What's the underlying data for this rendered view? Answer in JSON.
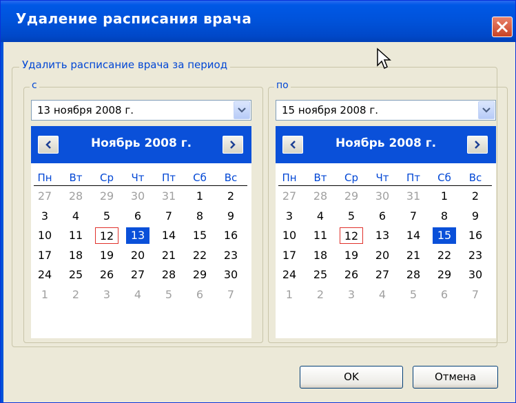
{
  "window": {
    "title": "Удаление расписания врача"
  },
  "group": {
    "legend": "Удалить расписание врача за период"
  },
  "from": {
    "legend": "с",
    "combo_value": "13  ноября   2008 г.",
    "month_label": "Ноябрь 2008 г.",
    "selected": "13",
    "today": "12"
  },
  "to": {
    "legend": "по",
    "combo_value": "15  ноября   2008 г.",
    "month_label": "Ноябрь 2008 г.",
    "selected": "15",
    "today": "12"
  },
  "weekdays": [
    "Пн",
    "Вт",
    "Ср",
    "Чт",
    "Пт",
    "Сб",
    "Вс"
  ],
  "weeks": [
    [
      {
        "d": "27",
        "o": true
      },
      {
        "d": "28",
        "o": true
      },
      {
        "d": "29",
        "o": true
      },
      {
        "d": "30",
        "o": true
      },
      {
        "d": "31",
        "o": true
      },
      {
        "d": "1",
        "o": false
      },
      {
        "d": "2",
        "o": false
      }
    ],
    [
      {
        "d": "3",
        "o": false
      },
      {
        "d": "4",
        "o": false
      },
      {
        "d": "5",
        "o": false
      },
      {
        "d": "6",
        "o": false
      },
      {
        "d": "7",
        "o": false
      },
      {
        "d": "8",
        "o": false
      },
      {
        "d": "9",
        "o": false
      }
    ],
    [
      {
        "d": "10",
        "o": false
      },
      {
        "d": "11",
        "o": false
      },
      {
        "d": "12",
        "o": false
      },
      {
        "d": "13",
        "o": false
      },
      {
        "d": "14",
        "o": false
      },
      {
        "d": "15",
        "o": false
      },
      {
        "d": "16",
        "o": false
      }
    ],
    [
      {
        "d": "17",
        "o": false
      },
      {
        "d": "18",
        "o": false
      },
      {
        "d": "19",
        "o": false
      },
      {
        "d": "20",
        "o": false
      },
      {
        "d": "21",
        "o": false
      },
      {
        "d": "22",
        "o": false
      },
      {
        "d": "23",
        "o": false
      }
    ],
    [
      {
        "d": "24",
        "o": false
      },
      {
        "d": "25",
        "o": false
      },
      {
        "d": "26",
        "o": false
      },
      {
        "d": "27",
        "o": false
      },
      {
        "d": "28",
        "o": false
      },
      {
        "d": "29",
        "o": false
      },
      {
        "d": "30",
        "o": false
      }
    ],
    [
      {
        "d": "1",
        "o": true
      },
      {
        "d": "2",
        "o": true
      },
      {
        "d": "3",
        "o": true
      },
      {
        "d": "4",
        "o": true
      },
      {
        "d": "5",
        "o": true
      },
      {
        "d": "6",
        "o": true
      },
      {
        "d": "7",
        "o": true
      }
    ]
  ],
  "buttons": {
    "ok": "OK",
    "cancel": "Отмена"
  },
  "colors": {
    "title_bar": "#0052d9",
    "accent": "#0046d5",
    "today_border": "#e0302a"
  },
  "icons": {
    "close": "close-icon",
    "cursor": "mouse-pointer-icon",
    "prev": "arrow-left-icon",
    "next": "arrow-right-icon",
    "dropdown": "chevron-down-icon"
  }
}
